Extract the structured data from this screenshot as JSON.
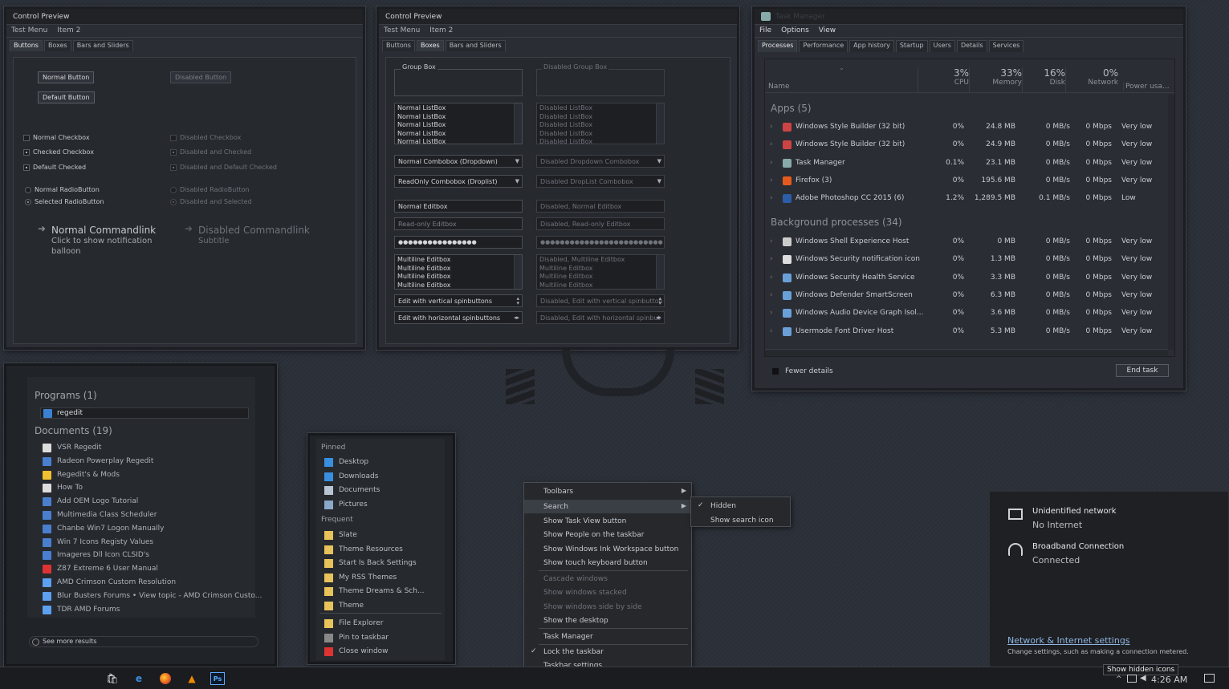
{
  "cp1": {
    "title": "Control Preview",
    "menu": [
      "Test Menu",
      "Item 2"
    ],
    "tabs": [
      "Buttons",
      "Boxes",
      "Bars and Sliders"
    ],
    "normal_button": "Normal Button",
    "disabled_button": "Disabled Button",
    "default_button": "Default Button",
    "normal_checkbox": "Normal Checkbox",
    "checked_checkbox": "Checked Checkbox",
    "default_checked": "Default Checked",
    "disabled_checkbox": "Disabled Checkbox",
    "disabled_checked": "Disabled and Checked",
    "disabled_default_checked": "Disabled and Default Checked",
    "normal_radio": "Normal RadioButton",
    "selected_radio": "Selected RadioButton",
    "disabled_radio": "Disabled RadioButton",
    "disabled_selected_radio": "Disabled and Selected",
    "cmdlink_title": "Normal Commandlink",
    "cmdlink_sub1": "Click to show notification",
    "cmdlink_sub2": "balloon",
    "cmdlink_dis_title": "Disabled Commandlink",
    "cmdlink_dis_sub": "Subtitle"
  },
  "cp2": {
    "title": "Control Preview",
    "menu": [
      "Test Menu",
      "Item 2"
    ],
    "tabs": [
      "Buttons",
      "Boxes",
      "Bars and Sliders"
    ],
    "group_box": "Group Box",
    "disabled_group_box": "Disabled Group Box",
    "listbox_items": [
      "Normal ListBox",
      "Normal ListBox",
      "Normal ListBox",
      "Normal ListBox",
      "Normal ListBox"
    ],
    "disabled_listbox_items": [
      "Disabled ListBox",
      "Disabled ListBox",
      "Disabled ListBox",
      "Disabled ListBox",
      "Disabled ListBox"
    ],
    "combo_dropdown": "Normal Combobox (Dropdown)",
    "combo_disabled_dropdown": "Disabled Dropdown Combobox",
    "combo_droplist": "ReadOnly Combobox (Droplist)",
    "combo_disabled_droplist": "Disabled DropList Combobox",
    "edit_normal": "Normal Editbox",
    "edit_disabled_normal": "Disabled, Normal Editbox",
    "edit_readonly": "Read-only Editbox",
    "edit_disabled_readonly": "Disabled, Read-only Editbox",
    "password": "●●●●●●●●●●●●●●●●",
    "password_disabled": "●●●●●●●●●●●●●●●●●●●●●●●●●",
    "multiline_items": [
      "Multiline Editbox",
      "Multiline Editbox",
      "Multiline Editbox",
      "Multiline Editbox"
    ],
    "disabled_multiline_items": [
      "Disabled, Multiline Editbox",
      "Multiline Editbox",
      "Multiline Editbox",
      "Multiline Editbox"
    ],
    "spin_vertical": "Edit with vertical spinbuttons",
    "spin_vertical_disabled": "Disabled, Edit with vertical spinbutton",
    "spin_horizontal": "Edit with horizontal spinbuttons",
    "spin_horizontal_disabled": "Disabled, Edit with horizontal spinbut"
  },
  "tm": {
    "title": "Task Manager",
    "menu": [
      "File",
      "Options",
      "View"
    ],
    "tabs": [
      "Processes",
      "Performance",
      "App history",
      "Startup",
      "Users",
      "Details",
      "Services"
    ],
    "col_name": "Name",
    "cols": [
      {
        "pct": "3%",
        "label": "CPU"
      },
      {
        "pct": "33%",
        "label": "Memory"
      },
      {
        "pct": "16%",
        "label": "Disk"
      },
      {
        "pct": "0%",
        "label": "Network"
      }
    ],
    "col_power": "Power usa...",
    "apps_group": "Apps (5)",
    "apps": [
      {
        "name": "Windows Style Builder (32 bit)",
        "cpu": "0%",
        "mem": "24.8 MB",
        "disk": "0 MB/s",
        "net": "0 Mbps",
        "power": "Very low",
        "icon": "#c44"
      },
      {
        "name": "Windows Style Builder (32 bit)",
        "cpu": "0%",
        "mem": "24.9 MB",
        "disk": "0 MB/s",
        "net": "0 Mbps",
        "power": "Very low",
        "icon": "#c44"
      },
      {
        "name": "Task Manager",
        "cpu": "0.1%",
        "mem": "23.1 MB",
        "disk": "0 MB/s",
        "net": "0 Mbps",
        "power": "Very low",
        "icon": "#8aa"
      },
      {
        "name": "Firefox (3)",
        "cpu": "0%",
        "mem": "195.6 MB",
        "disk": "0 MB/s",
        "net": "0 Mbps",
        "power": "Very low",
        "icon": "#e55b1e"
      },
      {
        "name": "Adobe Photoshop CC 2015 (6)",
        "cpu": "1.2%",
        "mem": "1,289.5 MB",
        "disk": "0.1 MB/s",
        "net": "0 Mbps",
        "power": "Low",
        "icon": "#2b5ea8"
      }
    ],
    "bg_group": "Background processes (34)",
    "bg": [
      {
        "name": "Windows Shell Experience Host",
        "cpu": "0%",
        "mem": "0 MB",
        "disk": "0 MB/s",
        "net": "0 Mbps",
        "power": "Very low",
        "icon": "#ccc"
      },
      {
        "name": "Windows Security notification icon",
        "cpu": "0%",
        "mem": "1.3 MB",
        "disk": "0 MB/s",
        "net": "0 Mbps",
        "power": "Very low",
        "icon": "#ddd"
      },
      {
        "name": "Windows Security Health Service",
        "cpu": "0%",
        "mem": "3.3 MB",
        "disk": "0 MB/s",
        "net": "0 Mbps",
        "power": "Very low",
        "icon": "#6aa0d8"
      },
      {
        "name": "Windows Defender SmartScreen",
        "cpu": "0%",
        "mem": "6.3 MB",
        "disk": "0 MB/s",
        "net": "0 Mbps",
        "power": "Very low",
        "icon": "#6aa0d8"
      },
      {
        "name": "Windows Audio Device Graph Isol...",
        "cpu": "0%",
        "mem": "3.6 MB",
        "disk": "0 MB/s",
        "net": "0 Mbps",
        "power": "Very low",
        "icon": "#6aa0d8"
      },
      {
        "name": "Usermode Font Driver Host",
        "cpu": "0%",
        "mem": "5.3 MB",
        "disk": "0 MB/s",
        "net": "0 Mbps",
        "power": "Very low",
        "icon": "#6aa0d8"
      }
    ],
    "fewer_details": "Fewer details",
    "end_task": "End task"
  },
  "start": {
    "programs_head": "Programs (1)",
    "program": "regedit",
    "documents_head": "Documents (19)",
    "documents": [
      "VSR Regedit",
      "Radeon Powerplay Regedit",
      "Regedit's & Mods",
      "How To",
      "Add OEM Logo Tutorial",
      "Multimedia Class Scheduler",
      "Chanbe Win7 Logon Manually",
      "Win 7 Icons Registy Values",
      "Imageres Dll Icon CLSID's",
      "Z87 Extreme 6 User Manual",
      "AMD Crimson Custom Resolution",
      "Blur Busters Forums • View topic - AMD Crimson Custo...",
      "TDR AMD Forums"
    ],
    "see_more": "See more results"
  },
  "jumplist": {
    "pinned_head": "Pinned",
    "pinned": [
      "Desktop",
      "Downloads",
      "Documents",
      "Pictures"
    ],
    "frequent_head": "Frequent",
    "frequent": [
      "Slate",
      "Theme Resources",
      "Start Is Back Settings",
      "My RSS Themes",
      "Theme Dreams & Sch...",
      "Theme"
    ],
    "actions": [
      "File Explorer",
      "Pin to taskbar",
      "Close window"
    ]
  },
  "ctxmenu": {
    "items": [
      "Toolbars",
      "Search",
      "Show Task View button",
      "Show People on the taskbar",
      "Show Windows Ink Workspace button",
      "Show touch keyboard button",
      "Cascade windows",
      "Show windows stacked",
      "Show windows side by side",
      "Show the desktop",
      "Task Manager",
      "Lock the taskbar",
      "Taskbar settings"
    ],
    "sub": [
      "Hidden",
      "Show search icon"
    ]
  },
  "network": {
    "net1_title": "Unidentified network",
    "net1_status": "No Internet",
    "net2_title": "Broadband Connection",
    "net2_status": "Connected",
    "settings_link": "Network & Internet settings",
    "settings_desc": "Change settings, such as making a connection metered."
  },
  "taskbar": {
    "tooltip": "Show hidden icons",
    "clock": "4:26 AM"
  },
  "colors": {
    "accent_link": "#8fb4e0"
  }
}
